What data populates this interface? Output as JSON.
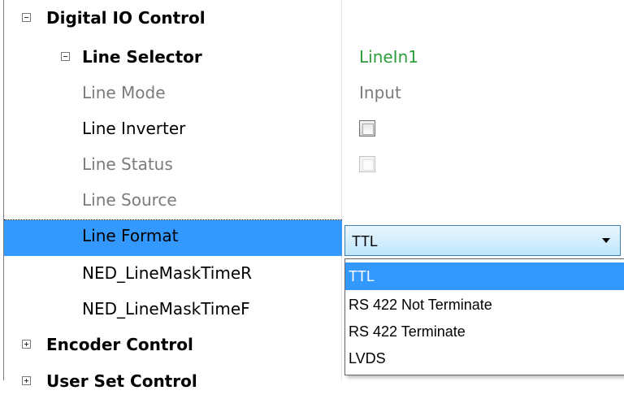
{
  "tree": {
    "digital_io_control": "Digital IO Control",
    "line_selector": {
      "label": "Line Selector",
      "value": "LineIn1"
    },
    "line_mode": {
      "label": "Line Mode",
      "value": "Input"
    },
    "line_inverter": {
      "label": "Line Inverter",
      "checked": false
    },
    "line_status": {
      "label": "Line Status",
      "checked": false
    },
    "line_source": {
      "label": "Line Source",
      "value": ""
    },
    "line_format": {
      "label": "Line Format",
      "value": "TTL"
    },
    "ned_line_mask_time_r": {
      "label": "NED_LineMaskTimeR"
    },
    "ned_line_mask_time_f": {
      "label": "NED_LineMaskTimeF"
    },
    "encoder_control": "Encoder Control",
    "user_set_control": "User Set Control"
  },
  "dropdown": {
    "options": [
      "TTL",
      "RS 422 Not Terminate",
      "RS 422 Terminate",
      "LVDS"
    ],
    "selected": "TTL"
  },
  "colors": {
    "selection": "#3399ff",
    "value_green": "#2e9e3a",
    "readonly_gray": "#7b7b7b"
  }
}
